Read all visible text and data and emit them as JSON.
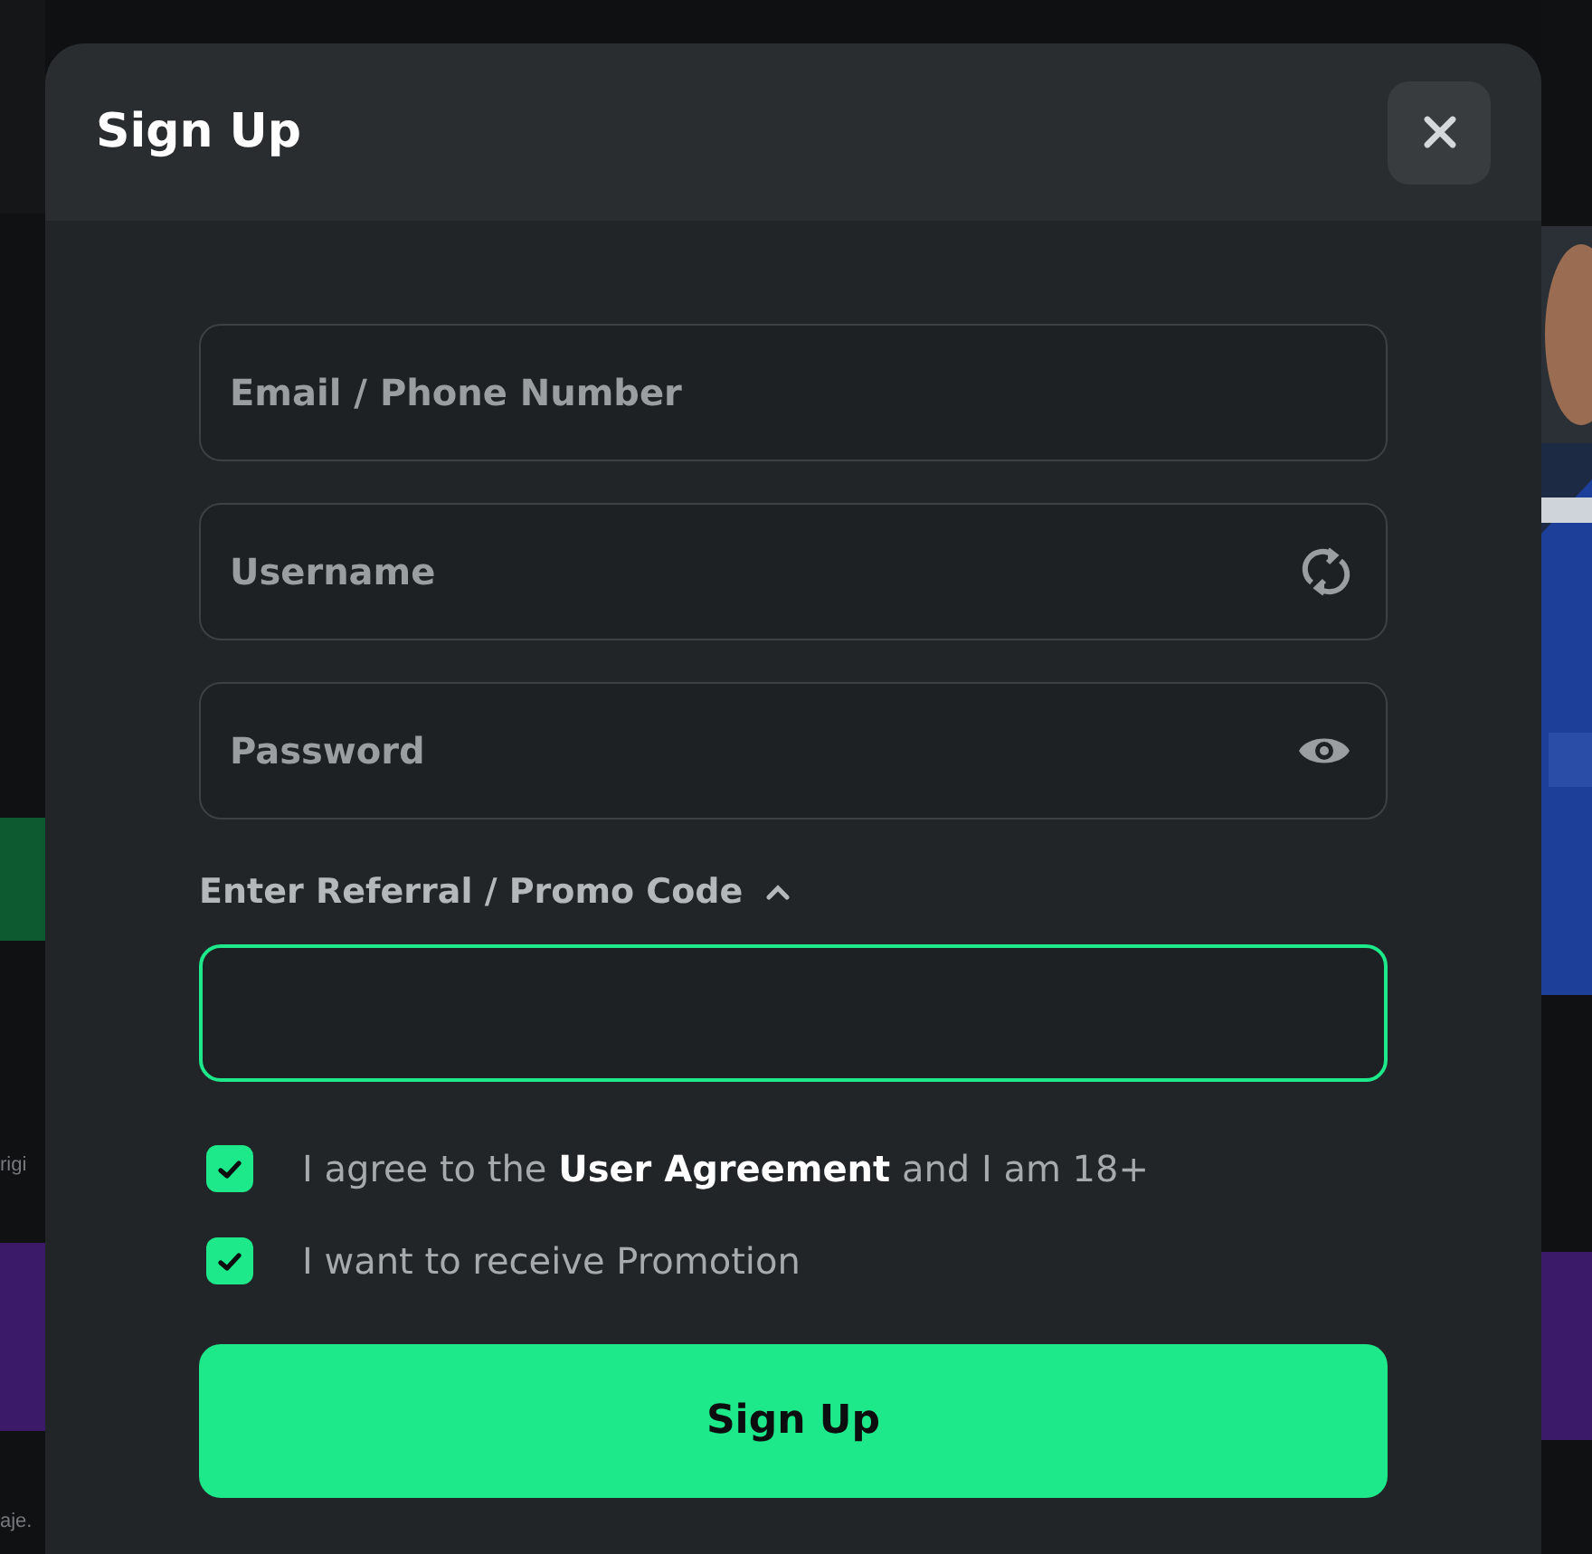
{
  "background": {
    "texts": [
      "rigi",
      "aje."
    ]
  },
  "modal": {
    "title": "Sign Up",
    "fields": [
      {
        "kind": "text",
        "placeholder": "Email / Phone Number"
      },
      {
        "kind": "username",
        "placeholder": "Username"
      },
      {
        "kind": "password",
        "placeholder": "Password"
      }
    ],
    "promo": {
      "label": "Enter Referral / Promo Code",
      "expanded": true,
      "focused": true
    },
    "checkboxes": [
      {
        "text": "I agree to the **User Agreement** and I am 18+",
        "checked": true
      },
      {
        "text": "I want to receive Promotion",
        "checked": true
      }
    ],
    "submit": "Sign Up"
  }
}
